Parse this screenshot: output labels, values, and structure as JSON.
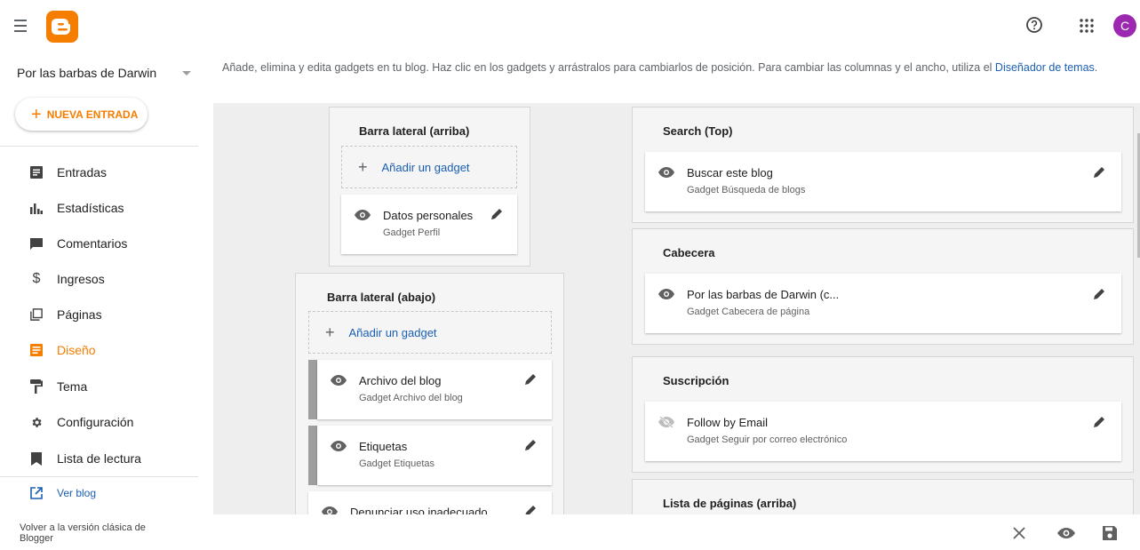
{
  "app": {
    "avatar_letter": "C",
    "brand_color": "#f57d00",
    "icons": [
      "menu-icon",
      "blogger-logo-icon",
      "help-icon",
      "apps-icon"
    ]
  },
  "sidebar": {
    "blog_name": "Por las barbas de Darwin",
    "new_post": "NUEVA ENTRADA",
    "items": [
      {
        "label": "Entradas",
        "icon": "posts-icon"
      },
      {
        "label": "Estadísticas",
        "icon": "stats-icon"
      },
      {
        "label": "Comentarios",
        "icon": "comments-icon"
      },
      {
        "label": "Ingresos",
        "icon": "dollar-icon"
      },
      {
        "label": "Páginas",
        "icon": "pages-icon"
      },
      {
        "label": "Diseño",
        "icon": "layout-icon",
        "active": true
      },
      {
        "label": "Tema",
        "icon": "paint-roller-icon"
      },
      {
        "label": "Configuración",
        "icon": "gear-icon"
      },
      {
        "label": "Lista de lectura",
        "icon": "bookmark-icon"
      }
    ],
    "view_blog": "Ver blog",
    "classic": "Volver a la versión clásica de Blogger"
  },
  "main": {
    "description": "Añade, elimina y edita gadgets en tu blog. Haz clic en los gadgets y arrástralos para cambiarlos de posición. Para cambiar las columnas y el ancho, utiliza el",
    "description_link": "Diseñador de temas",
    "description_end": ".",
    "add_gadget": "Añadir un gadget",
    "sections": {
      "sidebar_top": {
        "title": "Barra lateral (arriba)",
        "gadgets": [
          {
            "title": "Datos personales",
            "subtitle": "Gadget Perfil"
          }
        ]
      },
      "sidebar_bottom": {
        "title": "Barra lateral (abajo)",
        "gadgets": [
          {
            "title": "Archivo del blog",
            "subtitle": "Gadget Archivo del blog"
          },
          {
            "title": "Etiquetas",
            "subtitle": "Gadget Etiquetas"
          },
          {
            "title": "Denunciar uso inadecuado",
            "subtitle": ""
          }
        ]
      },
      "search_top": {
        "title": "Search (Top)",
        "gadgets": [
          {
            "title": "Buscar este blog",
            "subtitle": "Gadget Búsqueda de blogs"
          }
        ]
      },
      "header": {
        "title": "Cabecera",
        "gadgets": [
          {
            "title": "Por las barbas de Darwin (c...",
            "subtitle": "Gadget Cabecera de página"
          }
        ]
      },
      "subscription": {
        "title": "Suscripción",
        "gadgets": [
          {
            "title": "Follow by Email",
            "subtitle": "Gadget Seguir por correo electrónico",
            "hidden": true
          }
        ]
      },
      "pages_top": {
        "title": "Lista de páginas (arriba)",
        "gadgets": []
      }
    }
  },
  "bottombar": {
    "icons": [
      "close-icon",
      "preview-icon",
      "save-icon"
    ]
  }
}
